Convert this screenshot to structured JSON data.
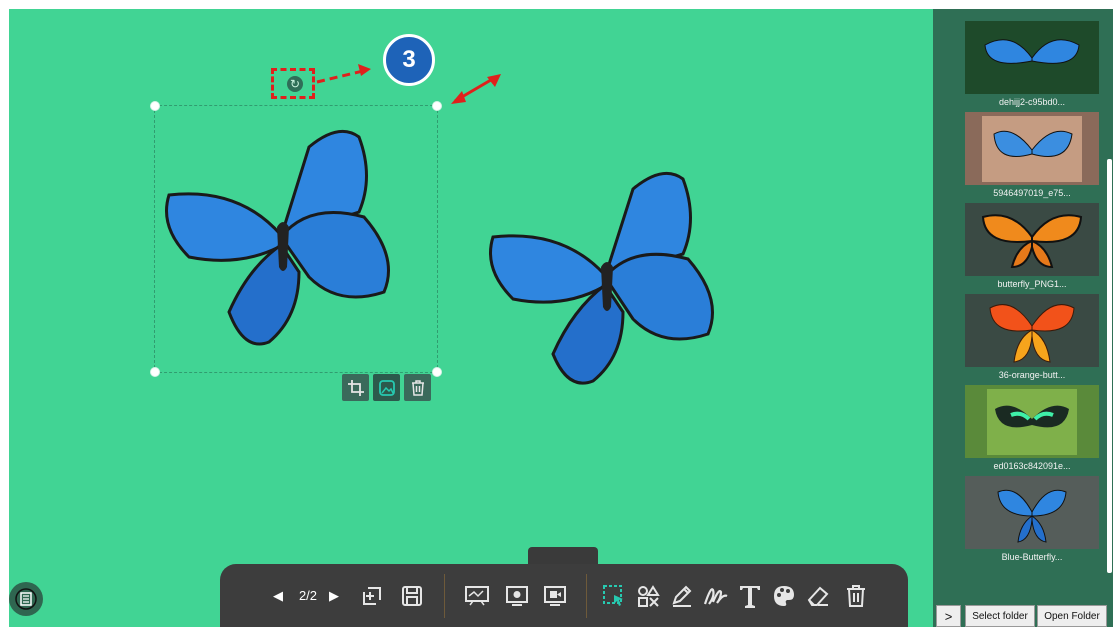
{
  "step_badge": "3",
  "pagination": {
    "page": "2/2",
    "prev_label": "◀",
    "next_label": "▶"
  },
  "sidebar": {
    "thumbnails": [
      {
        "label": "dehijj2-c95bd0..."
      },
      {
        "label": "5946497019_e75..."
      },
      {
        "label": "butterfly_PNG1..."
      },
      {
        "label": "36-orange-butt..."
      },
      {
        "label": "ed0163c842091e..."
      },
      {
        "label": "Blue-Butterfly..."
      }
    ],
    "expand_label": ">",
    "select_folder_label": "Select folder",
    "open_folder_label": "Open Folder"
  },
  "icons": {
    "object_toolbar": [
      "crop-icon",
      "image-icon",
      "trash-icon"
    ],
    "main_toolbar": [
      "add-page-icon",
      "save-icon",
      "whiteboard-icon",
      "camera-capture-icon",
      "video-record-icon",
      "select-icon",
      "shapes-icon",
      "pen-icon",
      "signature-icon",
      "text-icon",
      "palette-icon",
      "eraser-icon",
      "trash-icon"
    ]
  },
  "colors": {
    "canvas": "#41d494",
    "toolbar": "#3d3d3d",
    "sidebar": "#2f6f55",
    "accent": "#27c9b0",
    "highlight": "#e0201c",
    "badge": "#1e63b8"
  }
}
